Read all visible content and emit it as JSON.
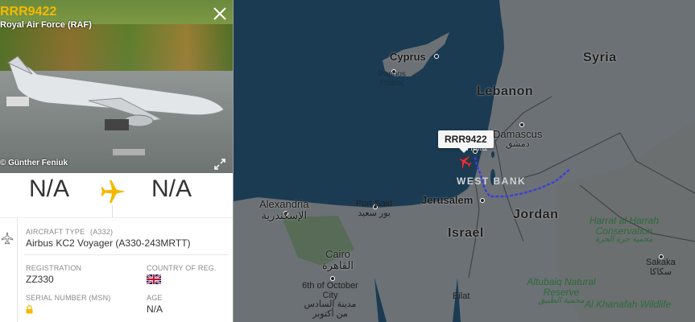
{
  "panel": {
    "callsign": "RRR9422",
    "operator": "Royal Air Force (RAF)",
    "photo_credit": "© Günther Feniuk",
    "route": {
      "from": "N/A",
      "to": "N/A"
    },
    "aircraft_type_label": "AIRCRAFT TYPE",
    "aircraft_type_code": "(A332)",
    "aircraft_type_value": "Airbus KC2 Voyager (A330-243MRTT)",
    "registration_label": "REGISTRATION",
    "registration_value": "ZZ330",
    "country_label": "COUNTRY OF REG.",
    "serial_label": "SERIAL NUMBER (MSN)",
    "age_label": "AGE",
    "age_value": "N/A"
  },
  "map": {
    "flight_label": "RRR9422",
    "labels": {
      "cyprus": "Cyprus",
      "paphos": "Paphos",
      "paphos_gr": "Πάφος",
      "syria": "Syria",
      "lebanon": "Lebanon",
      "damascus": "Damascus",
      "damascus_ar": "دمشق",
      "haifa": "Haifa",
      "west_bank": "WEST BANK",
      "jerusalem": "Jerusalem",
      "jordan": "Jordan",
      "israel": "Israel",
      "alexandria": "Alexandria",
      "alexandria_ar": "الإسكندرية",
      "port_said": "Port Said",
      "port_said_ar": "بور سعيد",
      "cairo": "Cairo",
      "cairo_ar": "القاهرة",
      "october_city": "6th of October City",
      "october_city_ar": "مدينة السادس من أكتوبر",
      "harrat": "Harrat al Harrah Conservation",
      "harrat_ar": "محمية حرة الحرة",
      "sakaka": "Sakaka",
      "sakaka_ar": "سكاكا",
      "altubaiq": "Altubaiq Natural Reserve",
      "altubaiq_ar": "محمية الطبيق",
      "al_khanafah": "Al Khanafah Wildlife",
      "eilat": "Eilat"
    }
  },
  "colors": {
    "callsign": "#f5b800",
    "track": "#3b3fd8",
    "aircraft_marker": "#e8353b",
    "sea": "#1b3b52",
    "land": "#6b6f73"
  }
}
